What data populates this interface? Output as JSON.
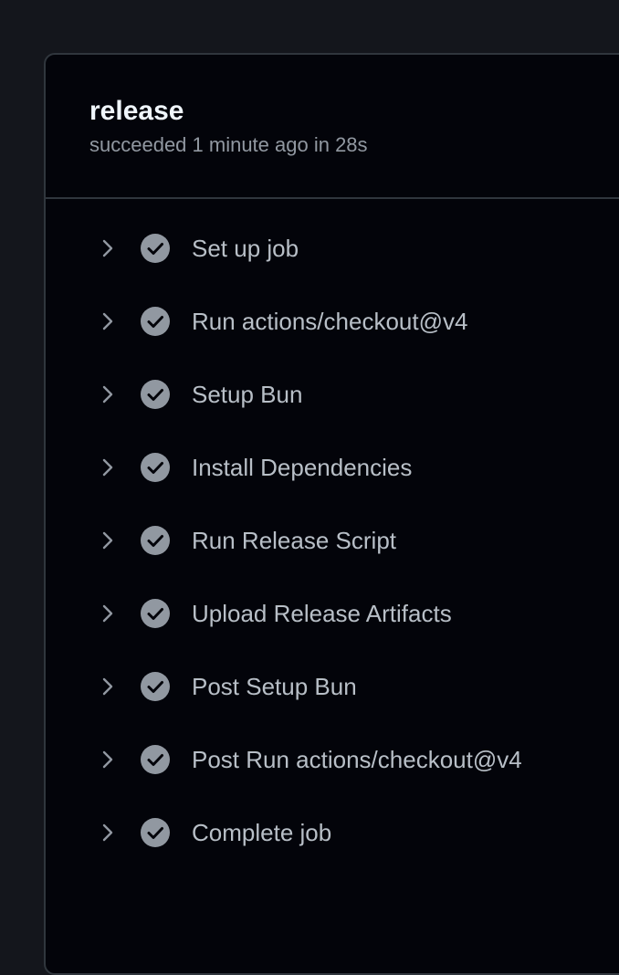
{
  "job": {
    "title": "release",
    "status": "succeeded 1 minute ago in 28s"
  },
  "colors": {
    "background": "#14161c",
    "panel": "#03040a",
    "border": "#30363d",
    "success_icon": "#9198a1"
  },
  "steps": [
    {
      "label": "Set up job",
      "state": "success",
      "icon": "check-circle-icon"
    },
    {
      "label": "Run actions/checkout@v4",
      "state": "success",
      "icon": "check-circle-icon"
    },
    {
      "label": "Setup Bun",
      "state": "success",
      "icon": "check-circle-icon"
    },
    {
      "label": "Install Dependencies",
      "state": "success",
      "icon": "check-circle-icon"
    },
    {
      "label": "Run Release Script",
      "state": "success",
      "icon": "check-circle-icon"
    },
    {
      "label": "Upload Release Artifacts",
      "state": "success",
      "icon": "check-circle-icon"
    },
    {
      "label": "Post Setup Bun",
      "state": "success",
      "icon": "check-circle-icon"
    },
    {
      "label": "Post Run actions/checkout@v4",
      "state": "success",
      "icon": "check-circle-icon"
    },
    {
      "label": "Complete job",
      "state": "success",
      "icon": "check-circle-icon"
    }
  ]
}
